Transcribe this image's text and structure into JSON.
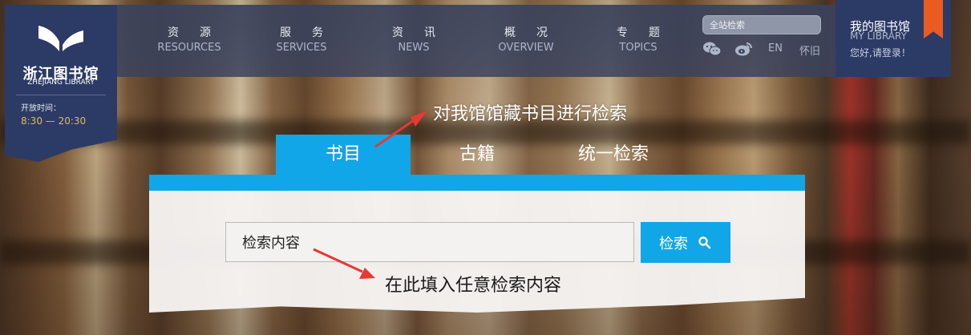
{
  "logo": {
    "name_cn": "浙江图书馆",
    "name_en": "ZHEJIANG LIBRARY",
    "hours_label": "开放时间：",
    "hours_value": "8:30 — 20:30",
    "icon": "book-logo-icon"
  },
  "nav": [
    {
      "cn": "资源",
      "en": "RESOURCES"
    },
    {
      "cn": "服务",
      "en": "SERVICES"
    },
    {
      "cn": "资讯",
      "en": "NEWS"
    },
    {
      "cn": "概况",
      "en": "OVERVIEW"
    },
    {
      "cn": "专题",
      "en": "TOPICS"
    }
  ],
  "site_search": {
    "placeholder": "全站检索"
  },
  "social": {
    "wechat_icon": "wechat-icon",
    "weibo_icon": "weibo-icon"
  },
  "languages": {
    "en": "EN",
    "old": "怀旧"
  },
  "my_library": {
    "title": "我的图书馆",
    "title_en": "MY LIBRARY",
    "login": "您好,请登录！"
  },
  "annotations": {
    "top": "对我馆馆藏书目进行检索",
    "bottom": "在此填入任意检索内容"
  },
  "tabs": [
    {
      "label": "书目"
    },
    {
      "label": "古籍"
    },
    {
      "label": "统一检索"
    }
  ],
  "search": {
    "value": "检索内容",
    "button_label": "检索",
    "button_icon": "search-icon"
  },
  "colors": {
    "accent": "#11a6e7",
    "navy": "#2c3a66",
    "bookmark": "#ec5a23",
    "arrow": "#e53935",
    "hours": "#e0b864"
  }
}
